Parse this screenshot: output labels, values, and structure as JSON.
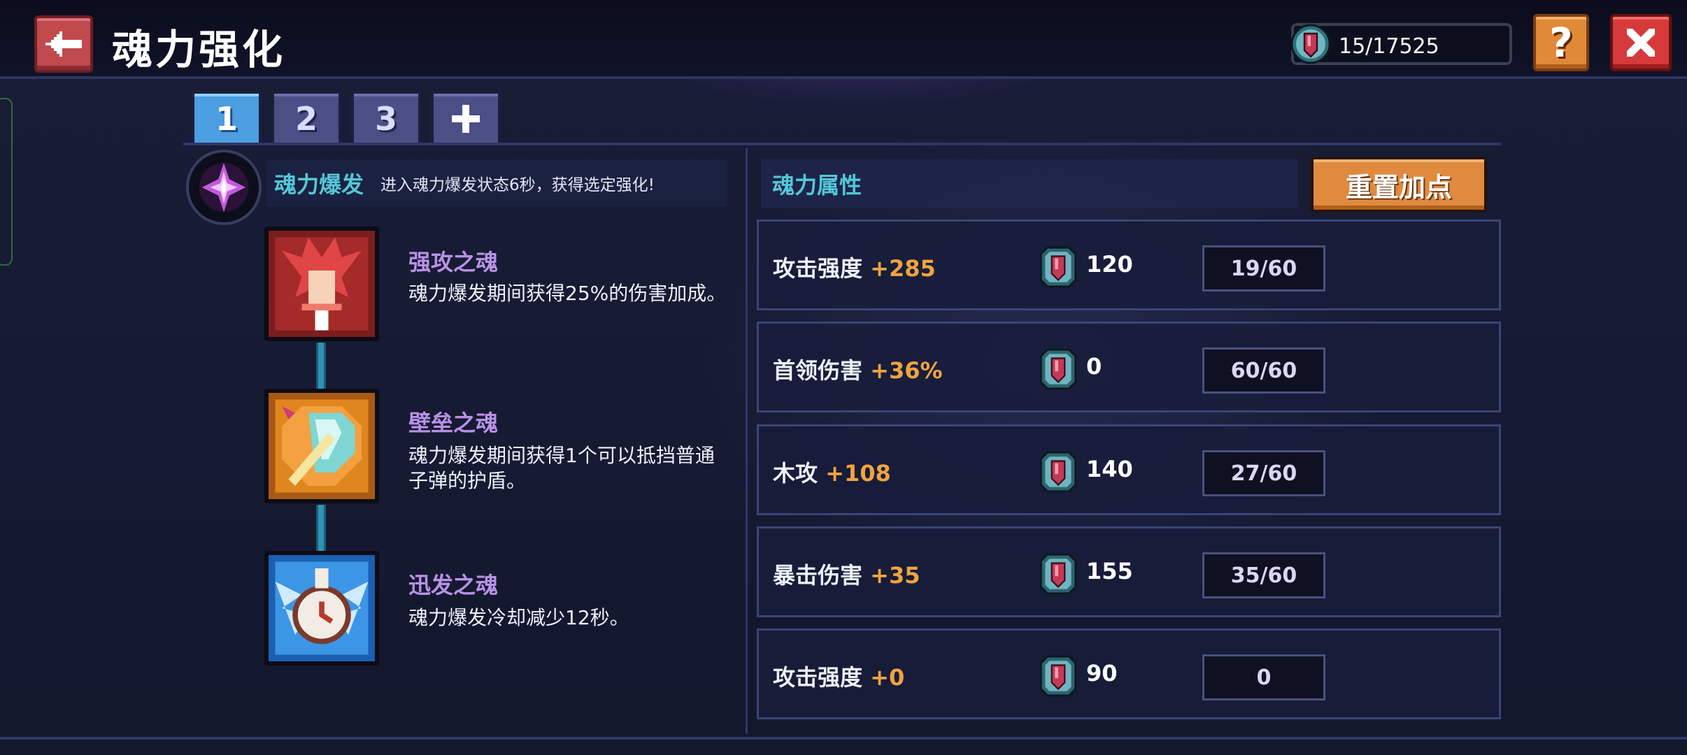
{
  "header": {
    "title": "魂力强化",
    "currency_value": "15/17525",
    "help_label": "?"
  },
  "tabs": [
    {
      "label": "1",
      "active": true
    },
    {
      "label": "2",
      "active": false
    },
    {
      "label": "3",
      "active": false
    },
    {
      "label": "+",
      "active": false
    }
  ],
  "burst": {
    "title": "魂力爆发",
    "description": "进入魂力爆发状态6秒，获得选定强化!"
  },
  "skills": [
    {
      "name": "强攻之魂",
      "description": "魂力爆发期间获得25%的伤害加成。",
      "icon": "attack-soul-icon"
    },
    {
      "name": "壁垒之魂",
      "description": "魂力爆发期间获得1个可以抵挡普通子弹的护盾。",
      "icon": "shield-soul-icon"
    },
    {
      "name": "迅发之魂",
      "description": "魂力爆发冷却减少12秒。",
      "icon": "rapid-soul-icon"
    }
  ],
  "attributes": {
    "title": "魂力属性",
    "reset_label": "重置加点",
    "rows": [
      {
        "name": "攻击强度",
        "bonus": "+285",
        "cost": "120",
        "level": "19/60"
      },
      {
        "name": "首领伤害",
        "bonus": "+36%",
        "cost": "0",
        "level": "60/60"
      },
      {
        "name": "木攻",
        "bonus": "+108",
        "cost": "140",
        "level": "27/60"
      },
      {
        "name": "暴击伤害",
        "bonus": "+35",
        "cost": "155",
        "level": "35/60"
      },
      {
        "name": "攻击强度",
        "bonus": "+0",
        "cost": "90",
        "level": "0"
      }
    ]
  },
  "colors": {
    "accent_cyan": "#52c8d8",
    "skill_purple": "#b991e6",
    "bonus_orange": "#f0a340",
    "active_tab": "#4b9ee0"
  }
}
